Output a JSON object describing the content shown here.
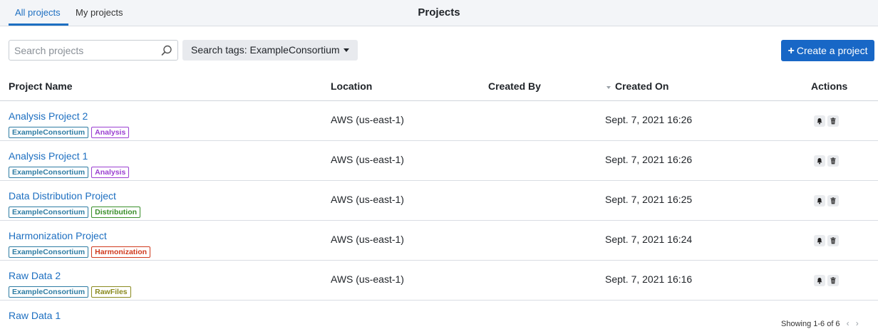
{
  "tabs": [
    {
      "label": "All projects"
    },
    {
      "label": "My projects"
    }
  ],
  "page_title": "Projects",
  "search": {
    "placeholder": "Search projects",
    "value": ""
  },
  "tags_filter": {
    "label": "Search tags: ExampleConsortium"
  },
  "create_button": {
    "label": "Create a project"
  },
  "columns": {
    "name": "Project Name",
    "location": "Location",
    "created_by": "Created By",
    "created_on": "Created On",
    "actions": "Actions"
  },
  "rows": [
    {
      "name": "Analysis Project 2",
      "tags": [
        {
          "text": "ExampleConsortium",
          "color": "#2e7ca3"
        },
        {
          "text": "Analysis",
          "color": "#9b3fd1"
        }
      ],
      "location": "AWS (us-east-1)",
      "created_by": "",
      "created_on": "Sept. 7, 2021 16:26"
    },
    {
      "name": "Analysis Project 1",
      "tags": [
        {
          "text": "ExampleConsortium",
          "color": "#2e7ca3"
        },
        {
          "text": "Analysis",
          "color": "#9b3fd1"
        }
      ],
      "location": "AWS (us-east-1)",
      "created_by": "",
      "created_on": "Sept. 7, 2021 16:26"
    },
    {
      "name": "Data Distribution Project",
      "tags": [
        {
          "text": "ExampleConsortium",
          "color": "#2e7ca3"
        },
        {
          "text": "Distribution",
          "color": "#3a8f2a"
        }
      ],
      "location": "AWS (us-east-1)",
      "created_by": "",
      "created_on": "Sept. 7, 2021 16:25"
    },
    {
      "name": "Harmonization Project",
      "tags": [
        {
          "text": "ExampleConsortium",
          "color": "#2e7ca3"
        },
        {
          "text": "Harmonization",
          "color": "#d0391d"
        }
      ],
      "location": "AWS (us-east-1)",
      "created_by": "",
      "created_on": "Sept. 7, 2021 16:24"
    },
    {
      "name": "Raw Data 2",
      "tags": [
        {
          "text": "ExampleConsortium",
          "color": "#2e7ca3"
        },
        {
          "text": "RawFiles",
          "color": "#8a8a1f"
        }
      ],
      "location": "AWS (us-east-1)",
      "created_by": "",
      "created_on": "Sept. 7, 2021 16:16"
    }
  ],
  "partial_row": {
    "name": "Raw Data 1"
  },
  "icons": {
    "search": "search-icon",
    "bell": "bell-icon",
    "trash": "trash-icon",
    "caret": "caret-down-icon",
    "sort": "sort-desc-icon",
    "prev": "chevron-left-icon",
    "next": "chevron-right-icon"
  },
  "colors": {
    "accent": "#1d6fc1",
    "button": "#1867c6"
  },
  "pager": {
    "label": "Showing 1-6 of 6",
    "prev": "‹",
    "next": "›"
  }
}
